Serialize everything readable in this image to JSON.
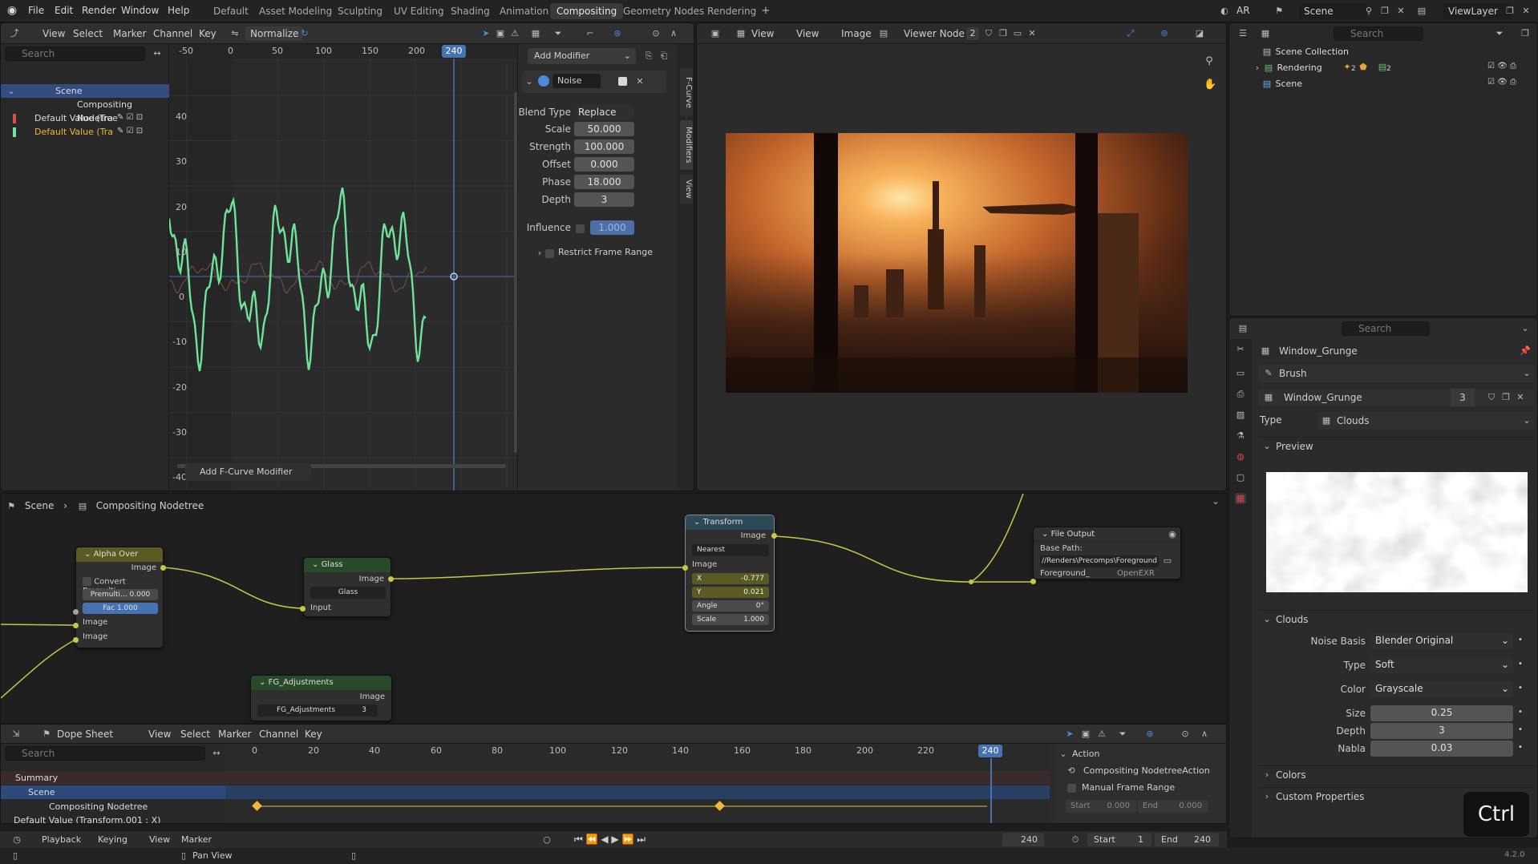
{
  "topbar": {
    "menus": [
      "File",
      "Edit",
      "Render",
      "Window",
      "Help"
    ],
    "workspaces": [
      "Default",
      "Asset Modeling",
      "Sculpting",
      "UV Editing",
      "Shading",
      "Animation",
      "Compositing",
      "Geometry Nodes",
      "Rendering"
    ],
    "active_workspace": "Compositing",
    "render_engine": "AR",
    "scene": "Scene",
    "view_layer": "ViewLayer"
  },
  "graph_editor": {
    "menus": [
      "View",
      "Select",
      "Marker",
      "Channel",
      "Key"
    ],
    "normalize": "Normalize",
    "search_placeholder": "Search",
    "channels": [
      "Scene",
      "Compositing Nodetree",
      "Default Value (Tra",
      "Default Value (Tra"
    ],
    "x_ticks": [
      "-50",
      "0",
      "50",
      "100",
      "150",
      "200"
    ],
    "current_frame": "240",
    "y_ticks": [
      "40",
      "30",
      "20",
      "10",
      "0",
      "-10",
      "-20",
      "-30",
      "-40"
    ],
    "add_modifier_btn": "Add F-Curve Modifier",
    "side_tabs": [
      "F-Curve",
      "Modifiers",
      "View"
    ],
    "modifier": {
      "add": "Add Modifier",
      "name": "Noise",
      "blend_type_label": "Blend Type",
      "blend_type": "Replace",
      "scale_label": "Scale",
      "scale": "50.000",
      "strength_label": "Strength",
      "strength": "100.000",
      "offset_label": "Offset",
      "offset": "0.000",
      "phase_label": "Phase",
      "phase": "18.000",
      "depth_label": "Depth",
      "depth": "3",
      "influence_label": "Influence",
      "influence": "1.000",
      "restrict": "Restrict Frame Range"
    }
  },
  "image_editor": {
    "menus": [
      "View",
      "View",
      "Image"
    ],
    "image_name": "Viewer Node",
    "slot": "2"
  },
  "outliner": {
    "search_placeholder": "Search",
    "rows": [
      "Scene Collection",
      "Rendering",
      "Scene"
    ],
    "badge1": "2",
    "badge2": "2"
  },
  "properties": {
    "search_placeholder": "Search",
    "texture_name": "Window_Grunge",
    "brush": "Brush",
    "texture_field": "Window_Grunge",
    "users": "3",
    "type_label": "Type",
    "type": "Clouds",
    "preview": "Preview",
    "clouds": "Clouds",
    "noise_basis_label": "Noise Basis",
    "noise_basis": "Blender Original",
    "ctype_label": "Type",
    "ctype": "Soft",
    "color_label": "Color",
    "color": "Grayscale",
    "size_label": "Size",
    "size": "0.25",
    "depth_label": "Depth",
    "depth": "3",
    "nabla_label": "Nabla",
    "nabla": "0.03",
    "colors": "Colors",
    "custom_props": "Custom Properties"
  },
  "node_editor": {
    "breadcrumb": [
      "Scene",
      "Compositing Nodetree"
    ],
    "alpha_over": {
      "title": "Alpha Over",
      "out": "Image",
      "convert": "Convert Premulti...",
      "premul_label": "Premulti...",
      "premul": "0.000",
      "fac_label": "Fac",
      "fac": "1.000",
      "in1": "Image",
      "in2": "Image"
    },
    "glass": {
      "title": "Glass",
      "out": "Image",
      "group": "Glass",
      "in": "Input"
    },
    "fg": {
      "title": "FG_Adjustments",
      "out": "Image",
      "group": "FG_Adjustments",
      "users": "3"
    },
    "transform": {
      "title": "Transform",
      "out": "Image",
      "filter": "Nearest",
      "in": "Image",
      "x_label": "X",
      "x": "-0.777",
      "y_label": "Y",
      "y": "0.021",
      "angle_label": "Angle",
      "angle": "0°",
      "scale_label": "Scale",
      "scale": "1.000"
    },
    "file_output": {
      "title": "File Output",
      "base_path_label": "Base Path:",
      "base_path": "//Renders\\Precomps\\Foreground",
      "input": "Foreground_",
      "format": "OpenEXR"
    }
  },
  "dopesheet": {
    "mode": "Dope Sheet",
    "menus": [
      "View",
      "Select",
      "Marker",
      "Channel",
      "Key"
    ],
    "search_placeholder": "Search",
    "channels": [
      "Summary",
      "Scene",
      "Compositing Nodetree",
      "Default Value (Transform.001 : X)"
    ],
    "ticks": [
      "0",
      "20",
      "40",
      "60",
      "80",
      "100",
      "120",
      "140",
      "160",
      "180",
      "200",
      "220"
    ],
    "current_frame": "240",
    "action": "Action",
    "action_name": "Compositing NodetreeAction",
    "manual_range": "Manual Frame Range",
    "start_label": "Start",
    "start_val": "0.000",
    "end_label": "End",
    "end_val": "0.000"
  },
  "timeline": {
    "menus": [
      "Playback",
      "Keying",
      "View",
      "Marker"
    ],
    "frame": "240",
    "start_label": "Start",
    "start": "1",
    "end_label": "End",
    "end": "240"
  },
  "statusbar": {
    "hint": "Pan View",
    "version": "4.2.0"
  },
  "key_overlay": "Ctrl",
  "colors": {
    "accent": "#4772b3",
    "curve": "#6fe39a",
    "active_ws": "#3a3a3a"
  }
}
